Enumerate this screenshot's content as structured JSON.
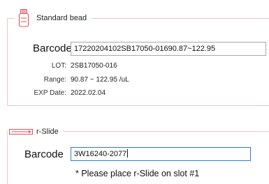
{
  "standard_bead": {
    "title": "Standard bead",
    "barcode_label": "Barcode",
    "barcode_value": "17220204102SB17050-01690.87~122.95",
    "lot_label": "LOT:",
    "lot_value": "2SB17050-016",
    "range_label": "Range:",
    "range_value": "90.87 ~ 122.95 /uL",
    "exp_label": "EXP Date:",
    "exp_value": "2022.02.04"
  },
  "r_slide": {
    "title": "r-Slide",
    "barcode_label": "Barcode",
    "barcode_value": "3W16240-2077",
    "note": "* Please place r-Slide on slot #1"
  },
  "colors": {
    "group_border": "#efc4c8",
    "icon_accent": "#d9535b",
    "focus_border": "#2b7bd0"
  },
  "icons": {
    "bead": "vial-icon",
    "slide": "slide-icon"
  }
}
